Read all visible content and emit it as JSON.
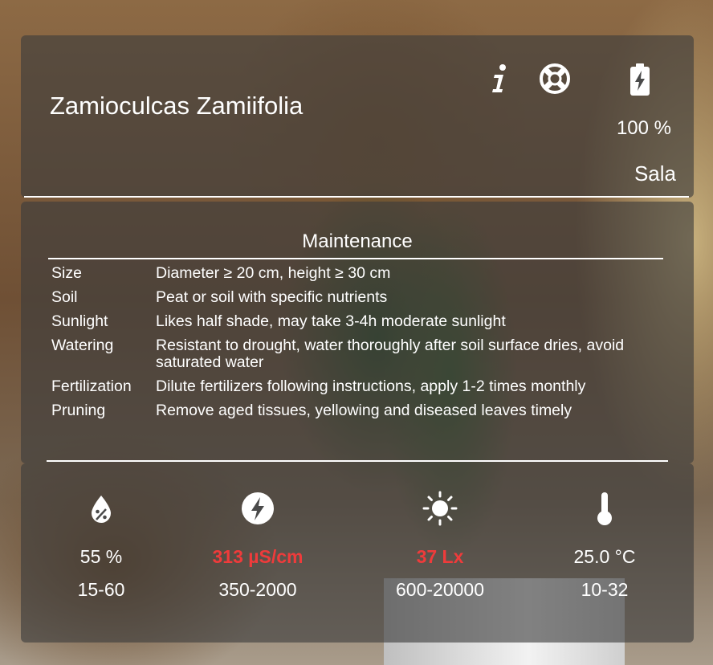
{
  "header": {
    "plant_name": "Zamioculcas Zamiifolia",
    "battery_value": "100 %",
    "location": "Sala"
  },
  "icons": {
    "info": "info-icon",
    "help": "lifebuoy-icon",
    "battery": "battery-charging-icon",
    "moisture": "water-drop-percent-icon",
    "fertility": "lightning-circle-icon",
    "light": "sun-icon",
    "temperature": "thermometer-icon"
  },
  "maintenance": {
    "title": "Maintenance",
    "rows": [
      {
        "key": "Size",
        "value": "Diameter ≥ 20 cm, height ≥ 30 cm"
      },
      {
        "key": "Soil",
        "value": "Peat or soil with specific nutrients"
      },
      {
        "key": "Sunlight",
        "value": "Likes half shade, may take 3-4h moderate sunlight"
      },
      {
        "key": "Watering",
        "value": "Resistant to drought, water thoroughly after soil surface dries, avoid saturated water"
      },
      {
        "key": "Fertilization",
        "value": "Dilute fertilizers following instructions, apply 1-2 times monthly"
      },
      {
        "key": "Pruning",
        "value": "Remove aged tissues, yellowing and diseased leaves timely"
      }
    ]
  },
  "sensors": {
    "moisture": {
      "value": "55 %",
      "range": "15-60"
    },
    "fertility": {
      "value": "313 µS/cm",
      "range": "350-2000"
    },
    "light": {
      "value": "37 Lx",
      "range": "600-20000"
    },
    "temperature": {
      "value": "25.0 °C",
      "range": "10-32"
    }
  },
  "colors": {
    "alert": "#ef3b3b",
    "text": "#ffffff",
    "panel": "rgba(60,60,60,0.62)"
  }
}
